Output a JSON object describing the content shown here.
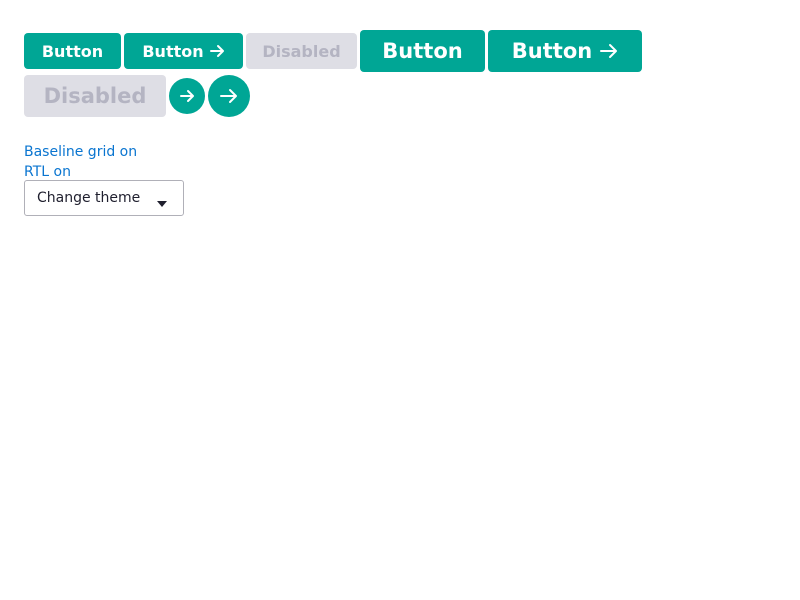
{
  "buttons": {
    "small_primary_label": "Button",
    "small_arrow_label": "Button",
    "small_disabled_label": "Disabled",
    "large_primary_label": "Button",
    "large_arrow_label": "Button",
    "large_disabled_label": "Disabled"
  },
  "links": {
    "baseline_grid": "Baseline grid on",
    "rtl": "RTL on"
  },
  "theme_select": {
    "selected": "Change theme"
  },
  "colors": {
    "primary": "#00a695",
    "disabled_bg": "#dedee5",
    "disabled_text": "#b4b4c2",
    "link": "#0a75d0"
  },
  "icons": {
    "arrow": "arrow-right-icon",
    "dropdown": "caret-down-icon"
  }
}
